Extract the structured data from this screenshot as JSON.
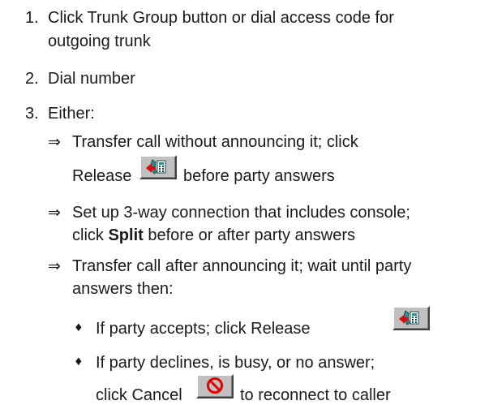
{
  "steps": [
    {
      "number": "1.",
      "lines": [
        "Click Trunk Group button or dial access code for",
        "outgoing trunk"
      ]
    },
    {
      "number": "2.",
      "lines": [
        "Dial number"
      ]
    },
    {
      "number": "3.",
      "lines": [
        "Either:"
      ]
    }
  ],
  "arrow_symbol": "⇒",
  "bullet_symbol": "♦",
  "options": {
    "transfer_unannounced": {
      "line1": "Transfer call without announcing it; click",
      "line2_before": "Release",
      "line2_after": "before party answers",
      "icon": "release-phone-icon"
    },
    "three_way": {
      "line1": "Set up 3-way connection that includes console;",
      "line2_prefix": "click ",
      "line2_bold": "Split",
      "line2_suffix": " before or after party answers"
    },
    "transfer_announced": {
      "line1": "Transfer call after announcing it; wait until party",
      "line2": "answers then:"
    }
  },
  "sub_options": {
    "accepts": {
      "text": "If party accepts; click Release",
      "icon": "release-phone-icon"
    },
    "declines": {
      "line1": "If party declines, is busy, or no answer;",
      "line2_before": "click Cancel",
      "line2_after": "to reconnect to caller",
      "icon": "cancel-no-entry-icon"
    }
  },
  "colors": {
    "text": "#1a1a1a",
    "button_face": "#c0c0c0",
    "cancel_red": "#e00000",
    "phone_teal": "#2e8b8b",
    "release_arrow_red": "#d01010"
  }
}
